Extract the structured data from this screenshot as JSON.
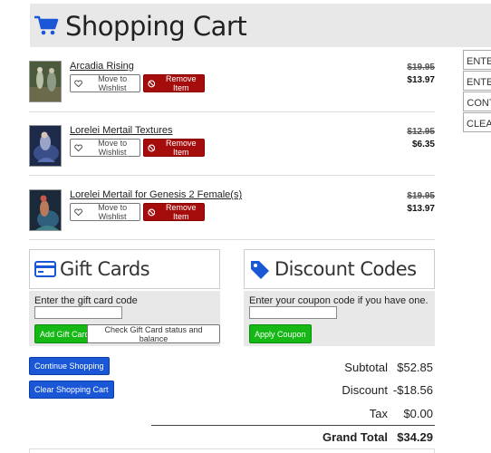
{
  "header": {
    "title": "Shopping Cart",
    "icon": "cart-icon",
    "accent": "#1a57d6"
  },
  "side_buttons": [
    "ENTER",
    "ENTER",
    "CONTI",
    "CLEAR"
  ],
  "items": [
    {
      "name": "Arcadia Rising",
      "wishlist_label": "Move to Wishlist",
      "remove_label": "Remove Item",
      "old_price": "$19.95",
      "new_price": "$13.97"
    },
    {
      "name": "Lorelei Mertail Textures",
      "wishlist_label": "Move to Wishlist",
      "remove_label": "Remove Item",
      "old_price": "$12.95",
      "new_price": "$6.35"
    },
    {
      "name": "Lorelei Mertail for Genesis 2 Female(s)",
      "wishlist_label": "Move to Wishlist",
      "remove_label": "Remove Item",
      "old_price": "$19.95",
      "new_price": "$13.97"
    }
  ],
  "gift_cards": {
    "title": "Gift Cards",
    "label": "Enter the gift card code",
    "input_value": "",
    "add_label": "Add Gift Card",
    "check_label": "Check Gift Card status and balance"
  },
  "discount_codes": {
    "title": "Discount Codes",
    "label": "Enter your coupon code if you have one.",
    "input_value": "",
    "apply_label": "Apply Coupon"
  },
  "actions": {
    "continue_label": "Continue Shopping",
    "clear_label": "Clear Shopping Cart"
  },
  "totals": {
    "subtotal_label": "Subtotal",
    "subtotal": "$52.85",
    "discount_label": "Discount",
    "discount": "-$18.56",
    "tax_label": "Tax",
    "tax": "$0.00",
    "grand_label": "Grand Total",
    "grand": "$34.29"
  },
  "colors": {
    "remove": "#a50d0d",
    "green": "#16b816",
    "blue": "#1a57d6"
  }
}
